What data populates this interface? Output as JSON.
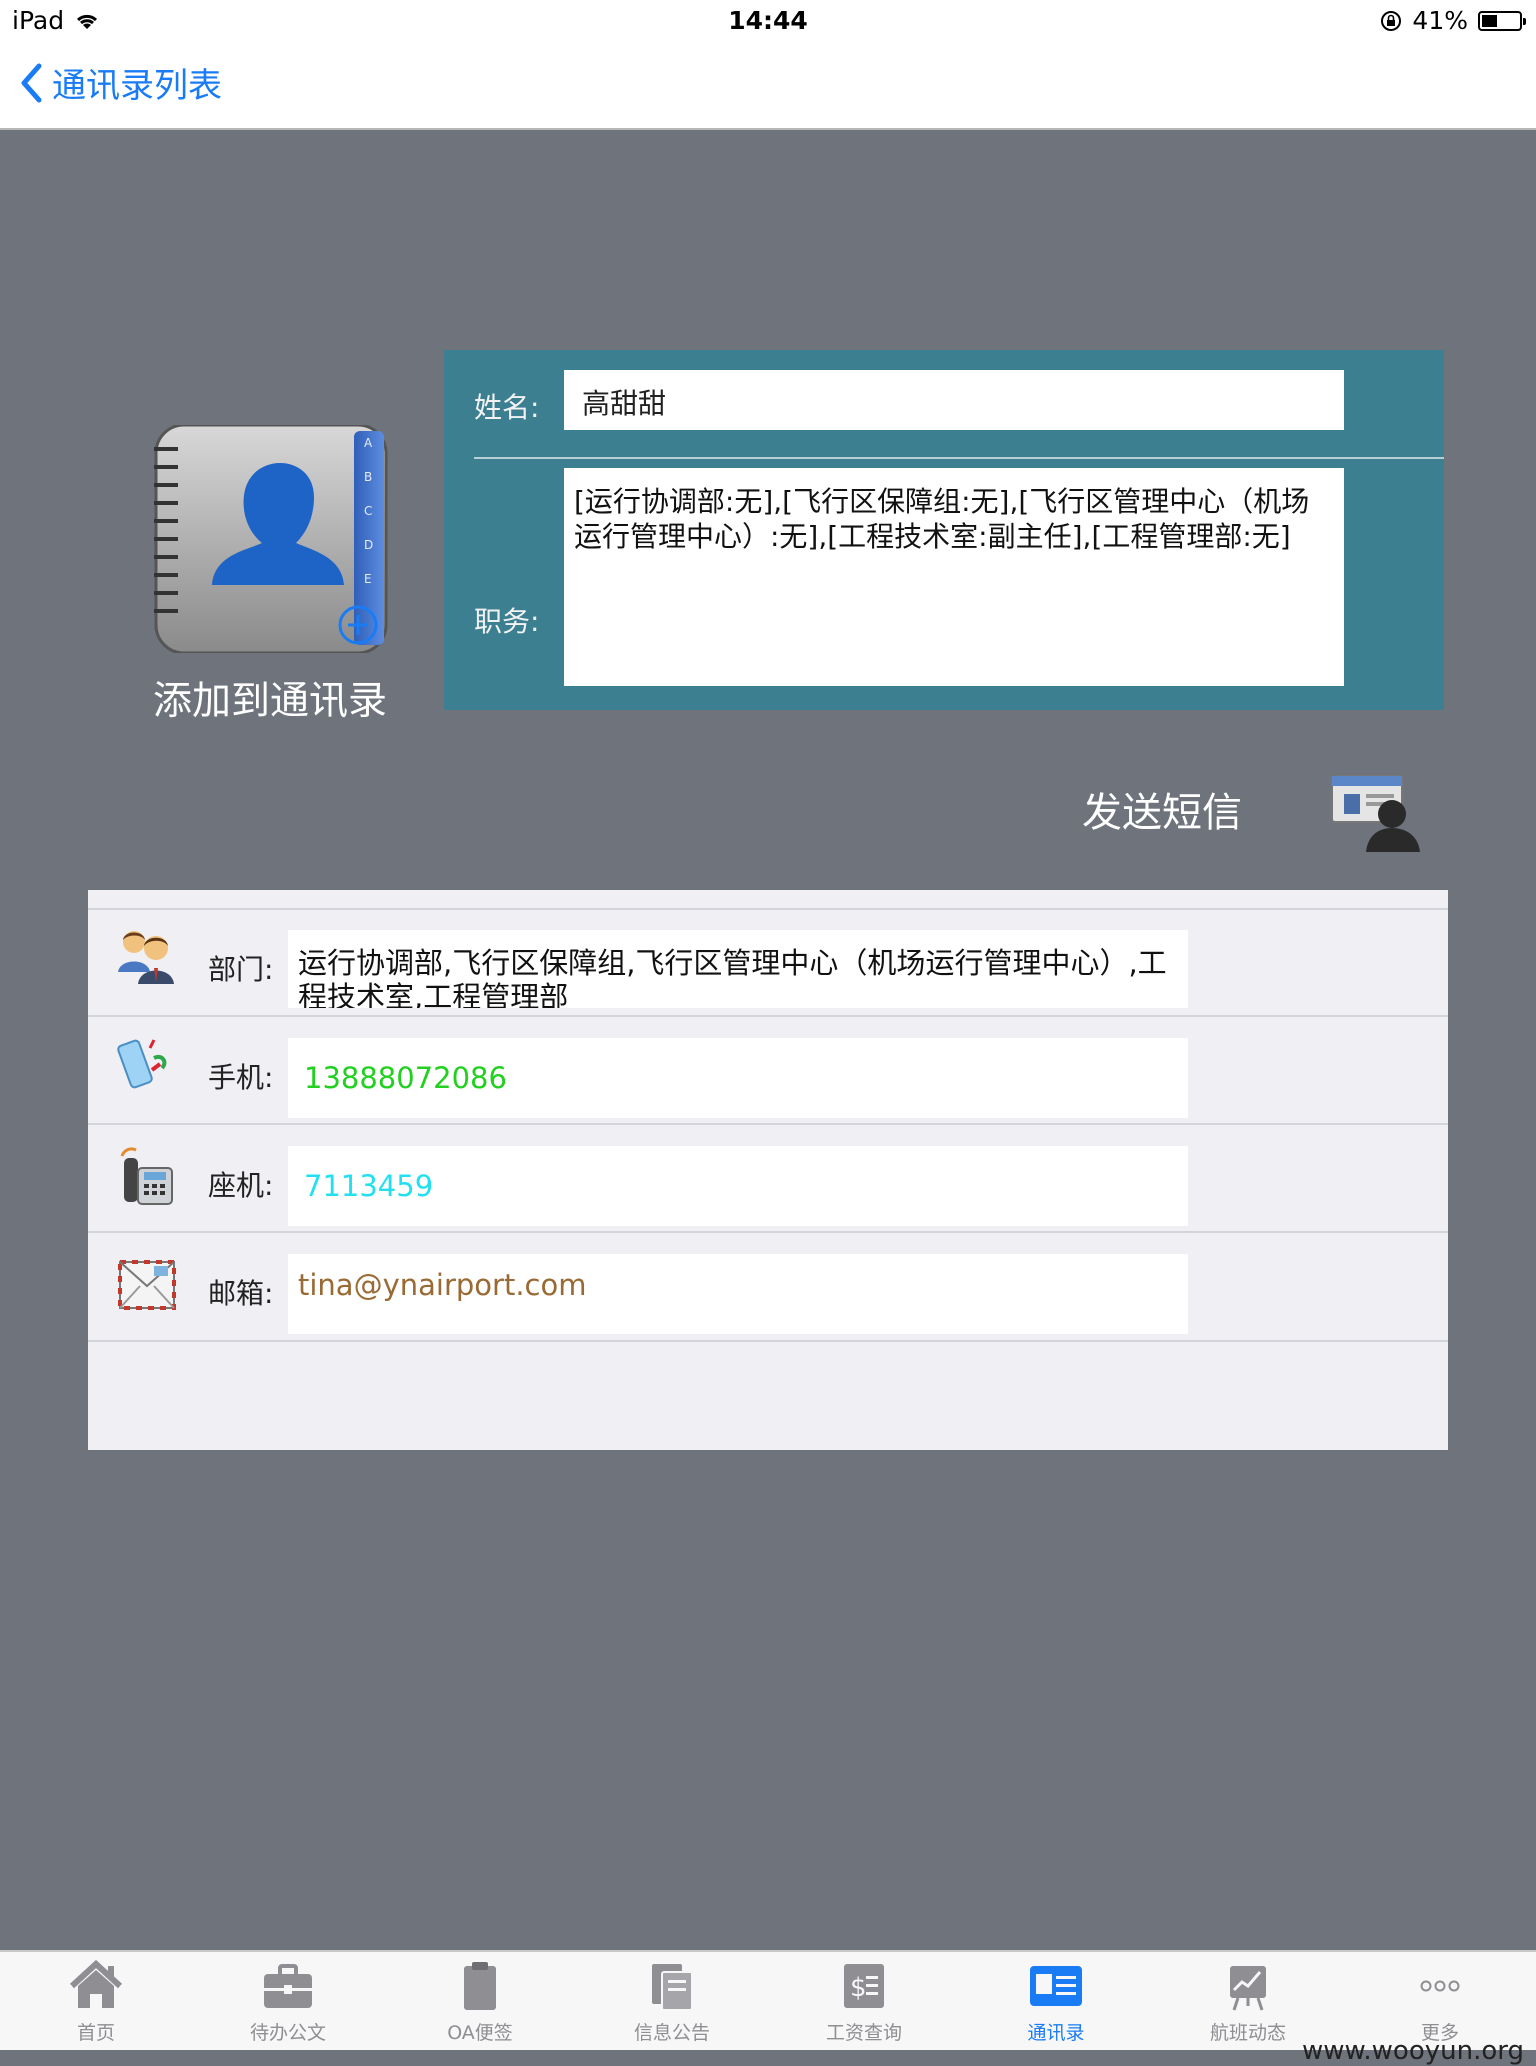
{
  "status_bar": {
    "device": "iPad",
    "time": "14:44",
    "battery": "41%",
    "battery_level": 0.41
  },
  "nav": {
    "back_label": "通讯录列表"
  },
  "contact": {
    "add_label": "添加到通讯录"
  },
  "info": {
    "name_label": "姓名:",
    "name_value": "高甜甜",
    "duty_label": "职务:",
    "duty_value": "[运行协调部:无],[飞行区保障组:无],[飞行区管理中心（机场运行管理中心）:无],[工程技术室:副主任],[工程管理部:无]"
  },
  "sms": {
    "label": "发送短信"
  },
  "details": {
    "dept": {
      "label": "部门:",
      "value": "运行协调部,飞行区保障组,飞行区管理中心（机场运行管理中心）,工程技术室,工程管理部"
    },
    "mobile": {
      "label": "手机:",
      "value": "13888072086",
      "color": "#22d11f"
    },
    "phone": {
      "label": "座机:",
      "value": "7113459",
      "color": "#22e0f0"
    },
    "email": {
      "label": "邮箱:",
      "value": "tina@ynairport.com",
      "color": "#9a6a34"
    }
  },
  "tabs": [
    {
      "label": "首页",
      "icon": "home-icon"
    },
    {
      "label": "待办公文",
      "icon": "briefcase-icon"
    },
    {
      "label": "OA便签",
      "icon": "clipboard-icon"
    },
    {
      "label": "信息公告",
      "icon": "bulletin-icon"
    },
    {
      "label": "工资查询",
      "icon": "salary-icon"
    },
    {
      "label": "通讯录",
      "icon": "contacts-icon",
      "active": true
    },
    {
      "label": "航班动态",
      "icon": "flight-chart-icon"
    },
    {
      "label": "更多",
      "icon": "more-icon"
    }
  ],
  "watermark": "www.wooyun.org"
}
